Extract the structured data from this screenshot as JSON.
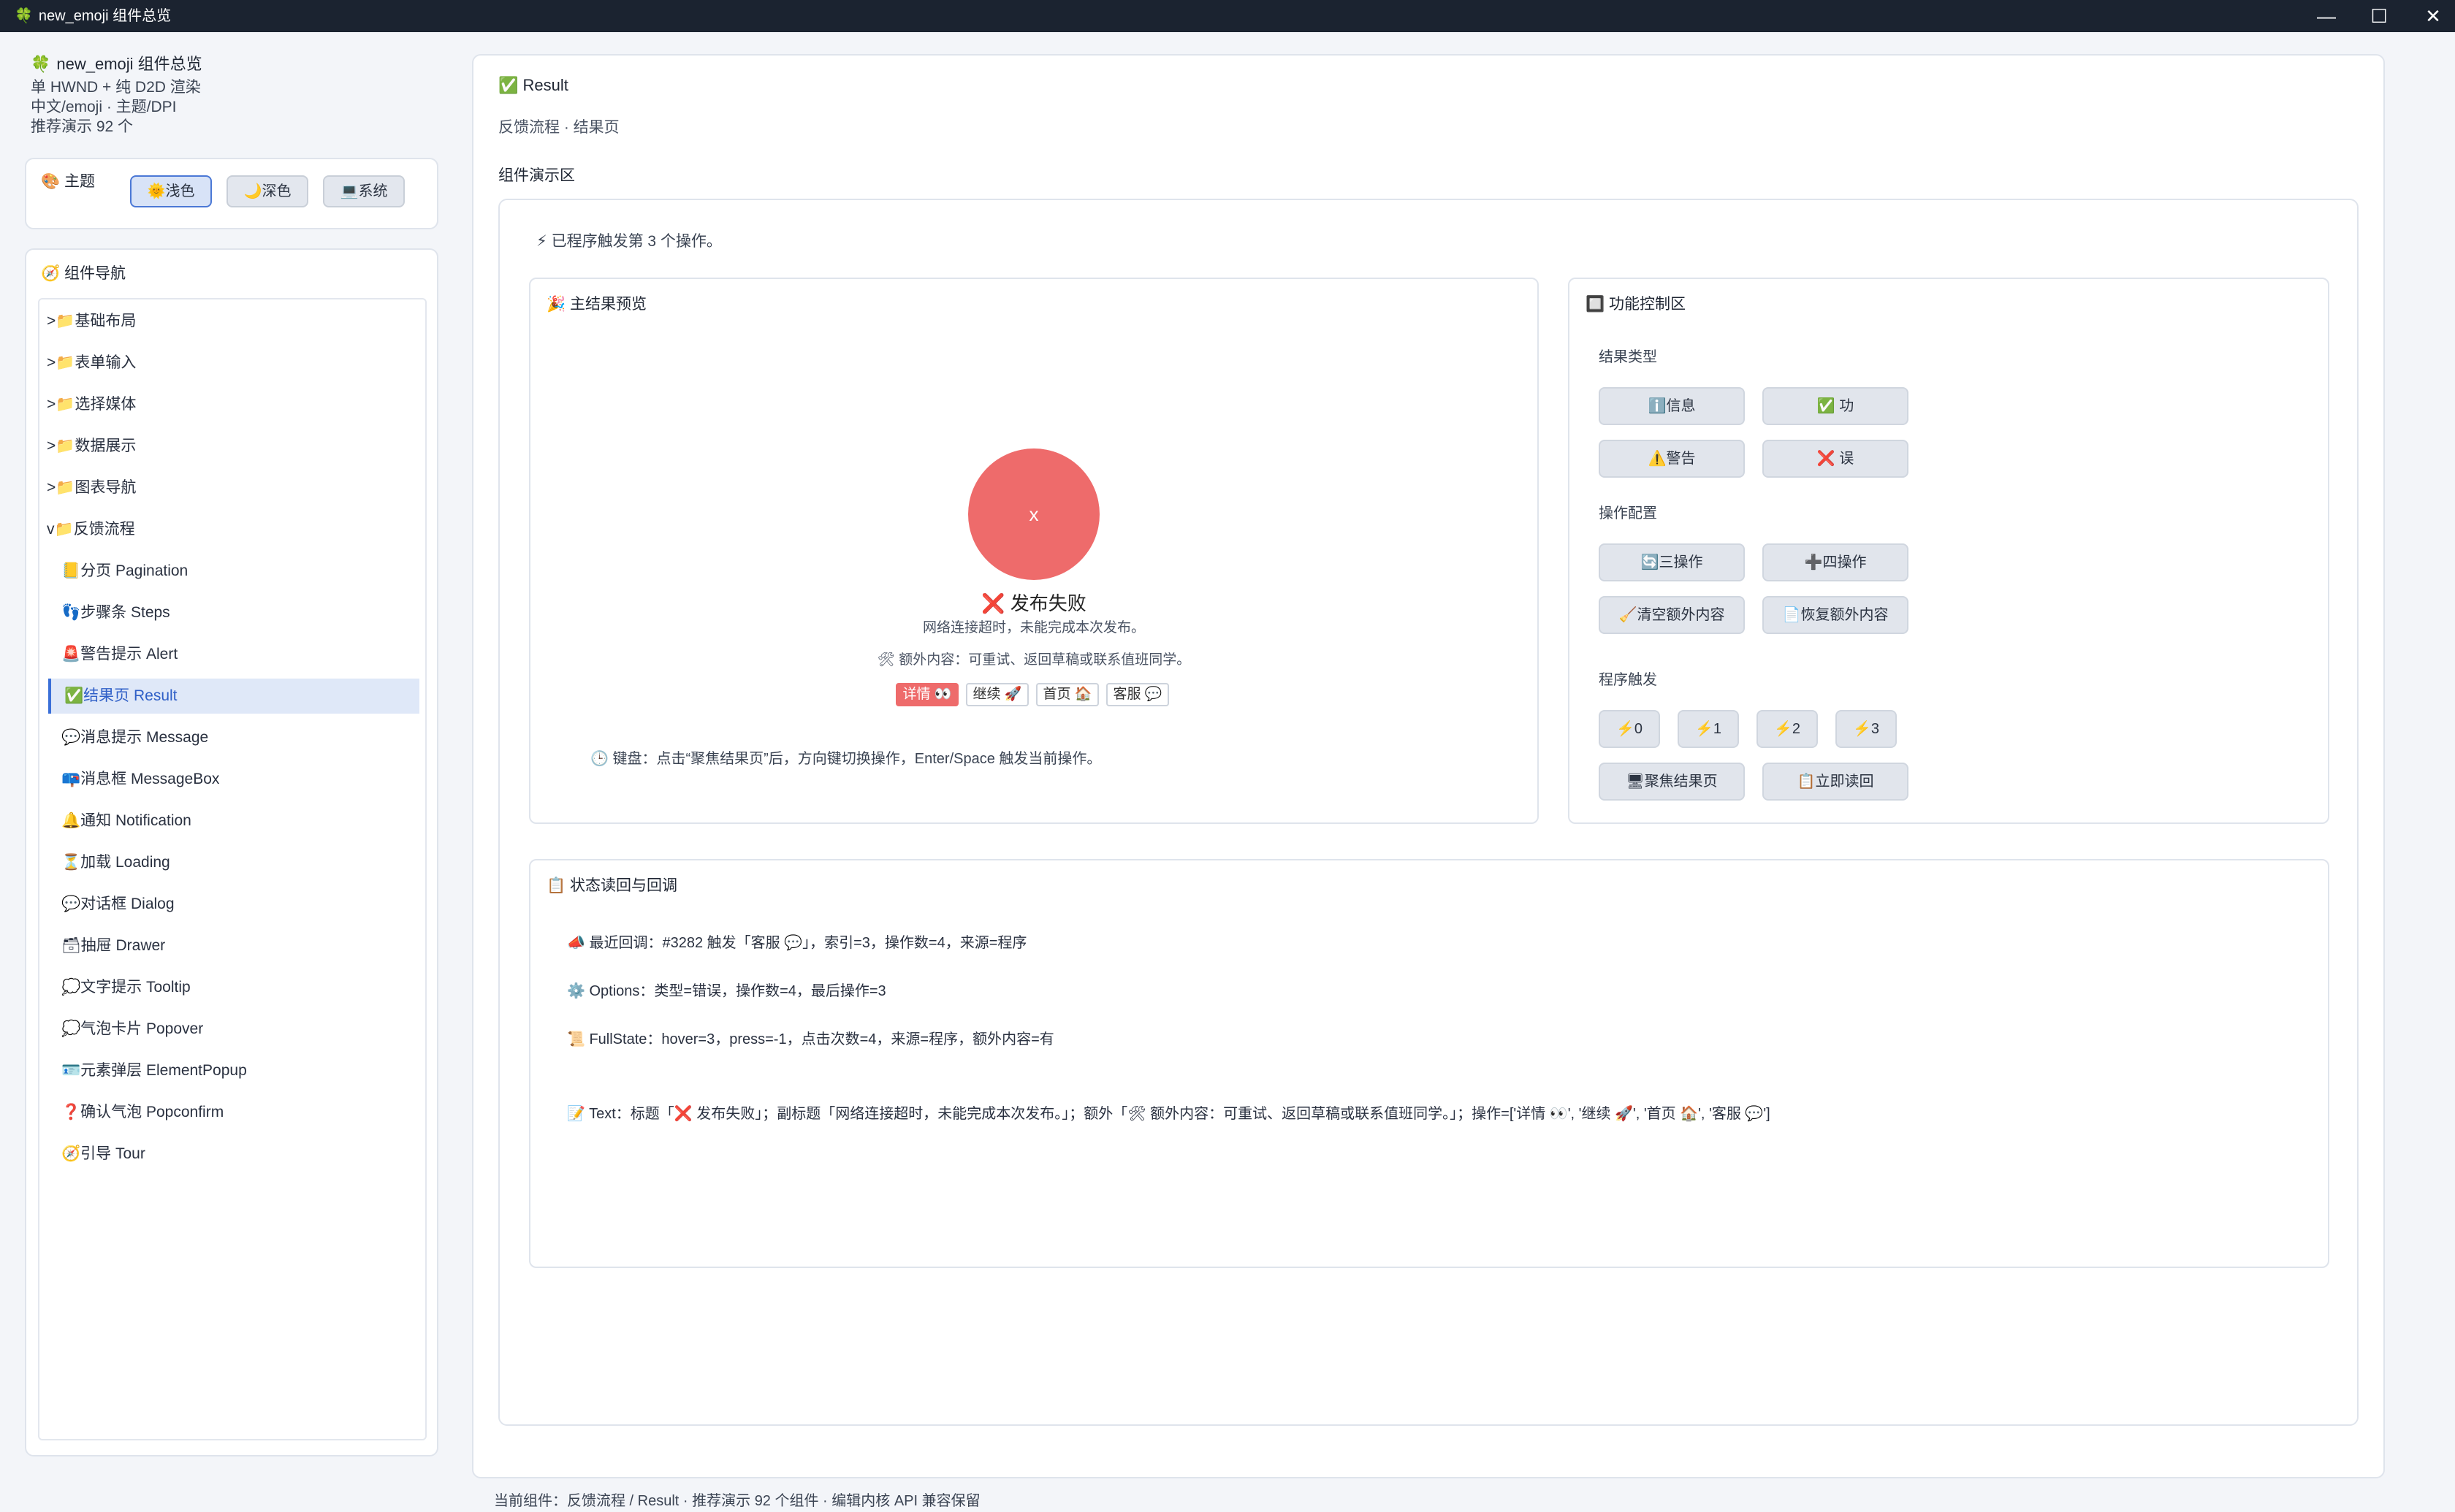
{
  "window": {
    "title": "new_emoji 组件总览",
    "icon": "🍀"
  },
  "sidebar": {
    "app_name": "new_emoji 组件总览",
    "app_icon": "🍀",
    "meta": [
      "单 HWND + 纯 D2D 渲染",
      "中文/emoji · 主题/DPI",
      "推荐演示 92 个"
    ],
    "theme": {
      "label": "🎨 主题",
      "buttons": [
        "🌞浅色",
        "🌙深色",
        "💻系统"
      ],
      "active": "🌞浅色"
    },
    "nav_title": "🧭 组件导航",
    "nav": [
      {
        "label": ">📁基础布局"
      },
      {
        "label": ">📁表单输入"
      },
      {
        "label": ">📁选择媒体"
      },
      {
        "label": ">📁数据展示"
      },
      {
        "label": ">📁图表导航"
      },
      {
        "label": "v📁反馈流程"
      },
      {
        "label": "📒分页 Pagination"
      },
      {
        "label": "👣步骤条 Steps"
      },
      {
        "label": "🚨警告提示 Alert"
      },
      {
        "label": "✅结果页 Result"
      },
      {
        "label": "💬消息提示 Message"
      },
      {
        "label": "📪消息框 MessageBox"
      },
      {
        "label": "🔔通知 Notification"
      },
      {
        "label": "⏳加载 Loading"
      },
      {
        "label": "💬对话框 Dialog"
      },
      {
        "label": "🗃抽屉 Drawer"
      },
      {
        "label": "💭文字提示 Tooltip"
      },
      {
        "label": "💭气泡卡片 Popover"
      },
      {
        "label": "🪪元素弹层 ElementPopup"
      },
      {
        "label": "❓确认气泡 Popconfirm"
      },
      {
        "label": "🧭引导 Tour"
      }
    ]
  },
  "main": {
    "title": "✅ Result",
    "subtitle": "反馈流程 · 结果页",
    "demo_title": "组件演示区",
    "trigger_msg": "⚡ 已程序触发第 3 个操作。",
    "preview": {
      "title": "🎉 主结果预览",
      "circle_text": "x",
      "result_title": "❌ 发布失败",
      "result_sub": "网络连接超时，未能完成本次发布。",
      "result_extra": "🛠 额外内容：可重试、返回草稿或联系值班同学。",
      "actions": [
        "详情 👀",
        "继续 🚀",
        "首页 🏠",
        "客服 💬"
      ],
      "keyboard_hint": "🕒 键盘：点击“聚焦结果页”后，方向键切换操作，Enter/Space 触发当前操作。"
    },
    "controls": {
      "title": "🔲 功能控制区",
      "type_label": "结果类型",
      "type_buttons": [
        "ℹ️信息",
        "✅ 功",
        "⚠️警告",
        "❌ 误"
      ],
      "ops_label": "操作配置",
      "ops_buttons": [
        "🔄三操作",
        "➕四操作",
        "🧹清空额外内容",
        "📄恢复额外内容"
      ],
      "trigger_label": "程序触发",
      "trigger_buttons": [
        "⚡0",
        "⚡1",
        "⚡2",
        "⚡3"
      ],
      "bottom_buttons": [
        "🖥聚焦结果页",
        "📋立即读回"
      ]
    },
    "state": {
      "title": "📋 状态读回与回调",
      "lines": [
        "📣 最近回调：#3282 触发「客服 💬」，索引=3，操作数=4，来源=程序",
        "⚙️ Options：类型=错误，操作数=4，最后操作=3",
        "📜 FullState：hover=3，press=-1，点击次数=4，来源=程序，额外内容=有",
        "📝 Text：标题「❌ 发布失败」；副标题「网络连接超时，未能完成本次发布。」；额外「🛠 额外内容：可重试、返回草稿或联系值班同学。」；操作=['详情 👀', '继续 🚀', '首页 🏠', '客服 💬']"
      ]
    }
  },
  "footer": "当前组件：反馈流程 / Result · 推荐演示 92 个组件 · 编辑内核 API 兼容保留",
  "colors": {
    "accent": "#3a6fd8",
    "error": "#ee6b6b",
    "titlebar": "#1b2330"
  }
}
